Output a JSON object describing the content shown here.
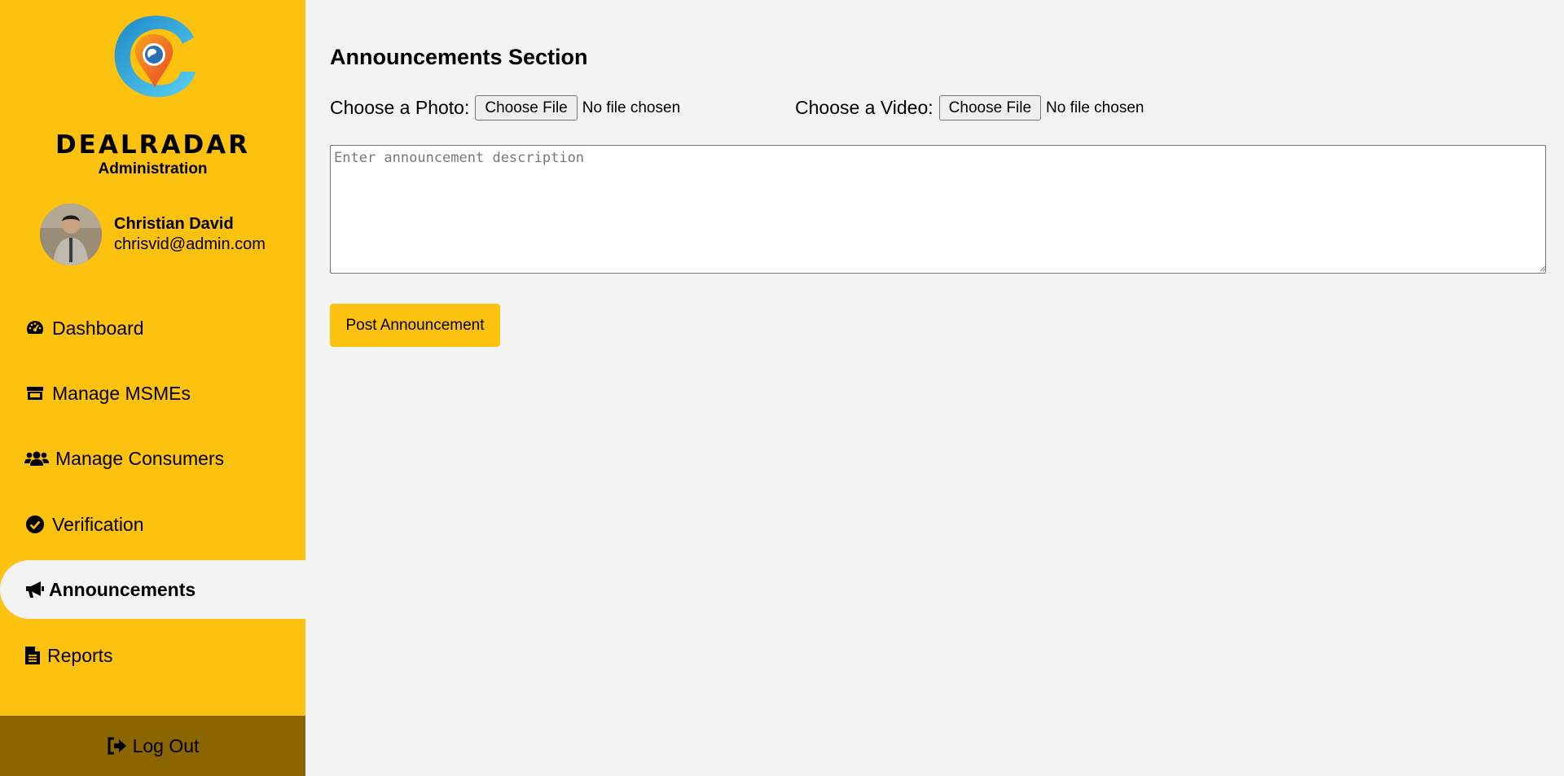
{
  "brand": {
    "name": "DEALRADAR",
    "subtitle": "Administration"
  },
  "user": {
    "name": "Christian David",
    "email": "chrisvid@admin.com"
  },
  "nav": [
    {
      "label": "Dashboard",
      "icon": "gauge-icon"
    },
    {
      "label": "Manage MSMEs",
      "icon": "store-icon"
    },
    {
      "label": "Manage Consumers",
      "icon": "users-icon"
    },
    {
      "label": "Verification",
      "icon": "check-circle-icon"
    },
    {
      "label": "Announcements",
      "icon": "megaphone-icon",
      "active": true
    },
    {
      "label": "Reports",
      "icon": "file-text-icon"
    }
  ],
  "logout": {
    "label": "Log Out",
    "icon": "sign-out-icon"
  },
  "main": {
    "title": "Announcements Section",
    "photo": {
      "label": "Choose a Photo:",
      "button": "Choose File",
      "status": "No file chosen"
    },
    "video": {
      "label": "Choose a Video:",
      "button": "Choose File",
      "status": "No file chosen"
    },
    "description_placeholder": "Enter announcement description",
    "post_button": "Post Announcement"
  },
  "colors": {
    "accent": "#fdc10f",
    "logout_bg": "#8b6500",
    "page_bg": "#f3f3f3"
  }
}
